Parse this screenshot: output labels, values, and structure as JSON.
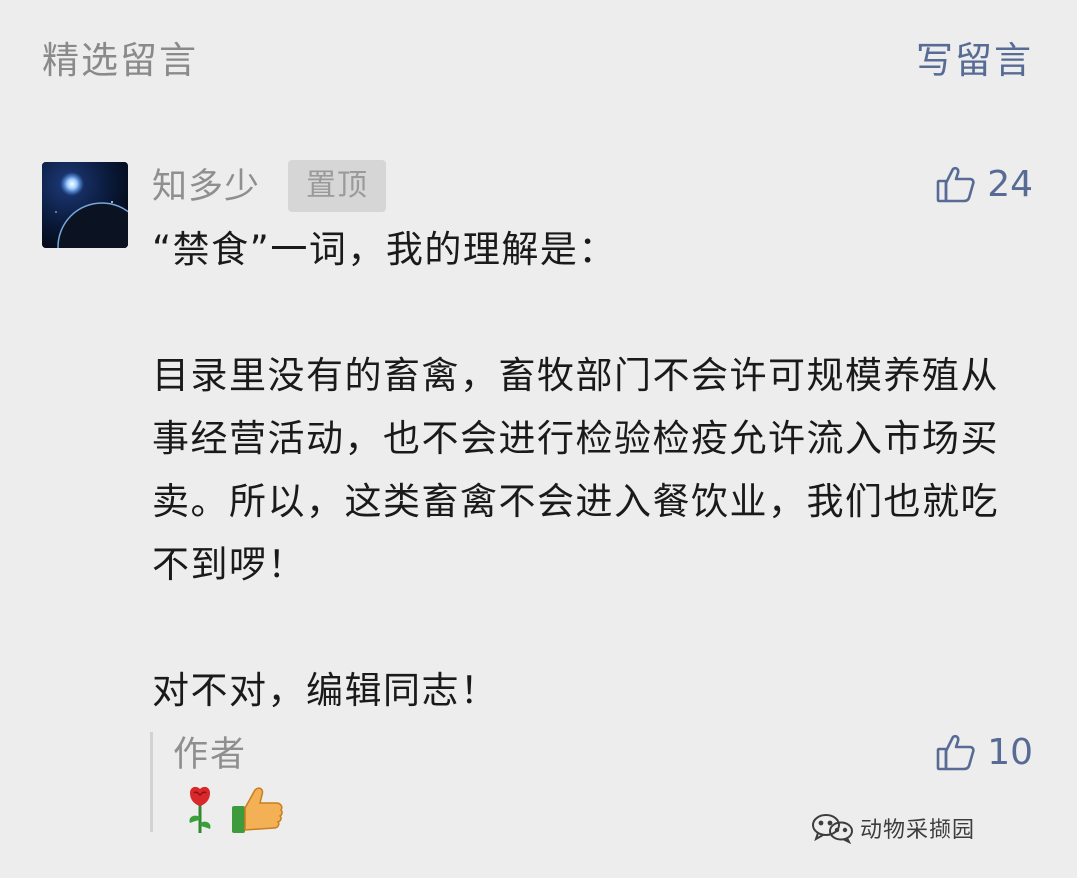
{
  "header": {
    "section_title": "精选留言",
    "write_comment_label": "写留言"
  },
  "comment": {
    "author": "知多少",
    "pinned_badge": "置顶",
    "likes": "24",
    "text": "“禁食”一词，我的理解是：\n\n目录里没有的畜禽，畜牧部门不会许可规模养殖从事经营活动，也不会进行检验检疫允许流入市场买卖。所以，这类畜禽不会进入餐饮业，我们也就吃不到啰！\n\n对不对，编辑同志！"
  },
  "reply": {
    "label": "作者",
    "likes": "10",
    "emojis": [
      "rose-emoji",
      "thumbs-up-emoji"
    ]
  },
  "watermark": {
    "text": "动物采撷园"
  },
  "colors": {
    "background": "#ededed",
    "link": "#576b95",
    "secondary_text": "#8f8f8f",
    "primary_text": "#1a1a1a"
  },
  "icons": [
    "thumbs-up-outline-icon",
    "wechat-logo-icon"
  ]
}
